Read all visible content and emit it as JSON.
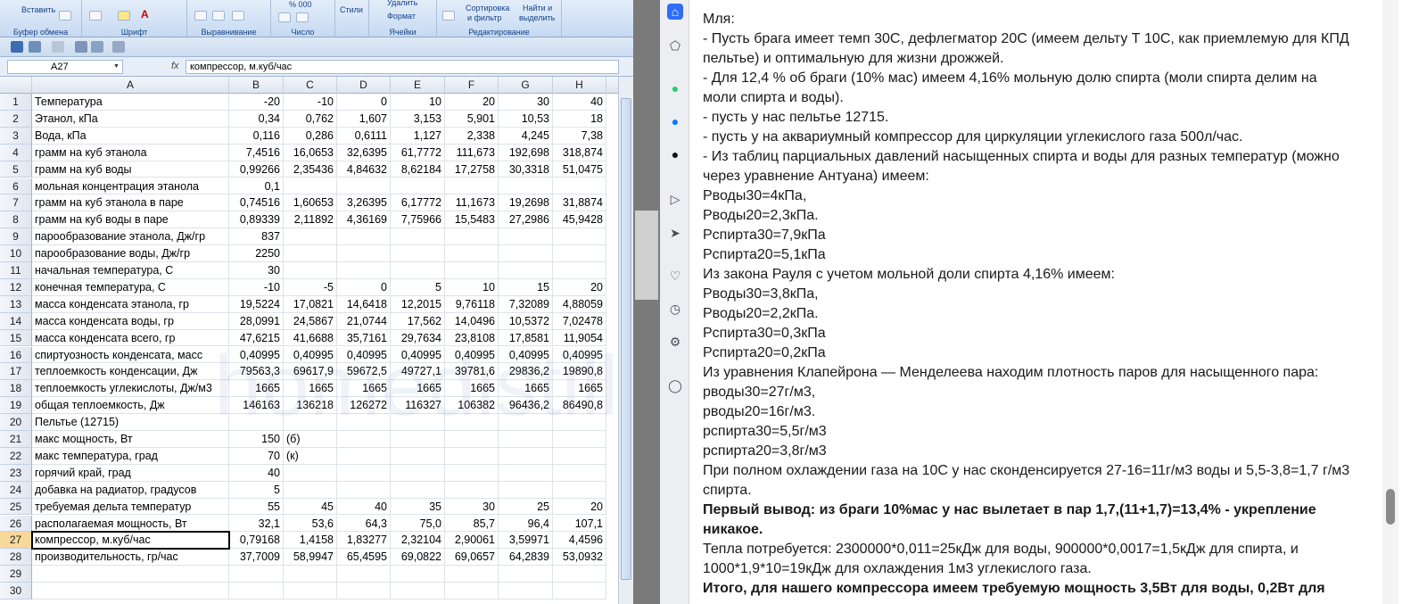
{
  "ribbon": {
    "groups": [
      "Буфер обмена",
      "Шрифт",
      "Выравнивание",
      "Число",
      "Ячейки",
      "Редактирование"
    ],
    "paste_label": "Вставить",
    "styles_label": "Стили",
    "format_label": "Формат",
    "delete_label": "Удалить",
    "sort_label": "Сортировка",
    "sort_label2": "и фильтр",
    "find_label": "Найти и",
    "find_label2": "выделить",
    "number_format": "% 000"
  },
  "formula_bar": {
    "name_box": "A27",
    "fx": "fx",
    "content": "компрессор, м.куб/час"
  },
  "columns": [
    "A",
    "B",
    "C",
    "D",
    "E",
    "F",
    "G",
    "H"
  ],
  "rows": [
    {
      "n": "1",
      "a": "Температура",
      "v": [
        "-20",
        "-10",
        "0",
        "10",
        "20",
        "30",
        "40"
      ]
    },
    {
      "n": "2",
      "a": "Этанол, кПа",
      "v": [
        "0,34",
        "0,762",
        "1,607",
        "3,153",
        "5,901",
        "10,53",
        "18"
      ]
    },
    {
      "n": "3",
      "a": "Вода, кПа",
      "v": [
        "0,116",
        "0,286",
        "0,6111",
        "1,127",
        "2,338",
        "4,245",
        "7,38"
      ]
    },
    {
      "n": "4",
      "a": "грамм на куб этанола",
      "v": [
        "7,4516",
        "16,0653",
        "32,6395",
        "61,7772",
        "111,673",
        "192,698",
        "318,874"
      ]
    },
    {
      "n": "5",
      "a": "грамм на куб воды",
      "v": [
        "0,99266",
        "2,35436",
        "4,84632",
        "8,62184",
        "17,2758",
        "30,3318",
        "51,0475"
      ]
    },
    {
      "n": "6",
      "a": "мольная концентрация этанола",
      "v": [
        "0,1",
        "",
        "",
        "",
        "",
        "",
        ""
      ]
    },
    {
      "n": "7",
      "a": "грамм на куб этанола в паре",
      "v": [
        "0,74516",
        "1,60653",
        "3,26395",
        "6,17772",
        "11,1673",
        "19,2698",
        "31,8874"
      ]
    },
    {
      "n": "8",
      "a": "грамм на куб воды в паре",
      "v": [
        "0,89339",
        "2,11892",
        "4,36169",
        "7,75966",
        "15,5483",
        "27,2986",
        "45,9428"
      ]
    },
    {
      "n": "9",
      "a": " парообразование этанола, Дж/гр",
      "v": [
        "837",
        "",
        "",
        "",
        "",
        "",
        ""
      ]
    },
    {
      "n": "10",
      "a": " парообразование воды, Дж/гр",
      "v": [
        "2250",
        "",
        "",
        "",
        "",
        "",
        ""
      ]
    },
    {
      "n": "11",
      "a": "начальная температура, С",
      "v": [
        "30",
        "",
        "",
        "",
        "",
        "",
        ""
      ]
    },
    {
      "n": "12",
      "a": "конечная температура, С",
      "v": [
        "-10",
        "-5",
        "0",
        "5",
        "10",
        "15",
        "20"
      ]
    },
    {
      "n": "13",
      "a": "масса конденсата этанола, гр",
      "v": [
        "19,5224",
        "17,0821",
        "14,6418",
        "12,2015",
        "9,76118",
        "7,32089",
        "4,88059"
      ]
    },
    {
      "n": "14",
      "a": "масса конденсата воды, гр",
      "v": [
        "28,0991",
        "24,5867",
        "21,0744",
        "17,562",
        "14,0496",
        "10,5372",
        "7,02478"
      ]
    },
    {
      "n": "15",
      "a": "масса конденсата всего, гр",
      "v": [
        "47,6215",
        "41,6688",
        "35,7161",
        "29,7634",
        "23,8108",
        "17,8581",
        "11,9054"
      ]
    },
    {
      "n": "16",
      "a": "спиртуозность  конденсата, масс",
      "v": [
        "0,40995",
        "0,40995",
        "0,40995",
        "0,40995",
        "0,40995",
        "0,40995",
        "0,40995"
      ]
    },
    {
      "n": "17",
      "a": "теплоемкость конденсации, Дж",
      "v": [
        "79563,3",
        "69617,9",
        "59672,5",
        "49727,1",
        "39781,6",
        "29836,2",
        "19890,8"
      ]
    },
    {
      "n": "18",
      "a": "теплоемкость углекислоты, Дж/м3",
      "v": [
        "1665",
        "1665",
        "1665",
        "1665",
        "1665",
        "1665",
        "1665"
      ]
    },
    {
      "n": "19",
      "a": "общая теплоемкость, Дж",
      "v": [
        "146163",
        "136218",
        "126272",
        "116327",
        "106382",
        "96436,2",
        "86490,8"
      ]
    },
    {
      "n": "20",
      "a": "Пельтье (12715)",
      "v": [
        "",
        "",
        "",
        "",
        "",
        "",
        ""
      ]
    },
    {
      "n": "21",
      "a": "макс мощность, Вт",
      "v": [
        "150",
        "(б)",
        "",
        "",
        "",
        "",
        ""
      ]
    },
    {
      "n": "22",
      "a": "макс температура, град",
      "v": [
        "70",
        "(к)",
        "",
        "",
        "",
        "",
        ""
      ]
    },
    {
      "n": "23",
      "a": "горячий край, град",
      "v": [
        "40",
        "",
        "",
        "",
        "",
        "",
        ""
      ]
    },
    {
      "n": "24",
      "a": "добавка на радиатор, градусов",
      "v": [
        "5",
        "",
        "",
        "",
        "",
        "",
        ""
      ]
    },
    {
      "n": "25",
      "a": "требуемая дельта температур",
      "v": [
        "55",
        "45",
        "40",
        "35",
        "30",
        "25",
        "20"
      ]
    },
    {
      "n": "26",
      "a": "располагаемая мощность, Вт",
      "v": [
        "32,1",
        "53,6",
        "64,3",
        "75,0",
        "85,7",
        "96,4",
        "107,1"
      ]
    },
    {
      "n": "27",
      "a": "компрессор, м.куб/час",
      "v": [
        "0,79168",
        "1,4158",
        "1,83277",
        "2,32104",
        "2,90061",
        "3,59971",
        "4,4596"
      ]
    },
    {
      "n": "28",
      "a": "производительность, гр/час",
      "v": [
        "37,7009",
        "58,9947",
        "65,4595",
        "69,0822",
        "69,0657",
        "64,2839",
        "53,0932"
      ]
    },
    {
      "n": "29",
      "a": "",
      "v": [
        "",
        "",
        "",
        "",
        "",
        "",
        ""
      ]
    },
    {
      "n": "30",
      "a": "",
      "v": [
        "",
        "",
        "",
        "",
        "",
        "",
        ""
      ]
    }
  ],
  "article": {
    "lines": [
      {
        "t": "Мля:",
        "b": false
      },
      {
        "t": "- Пусть брага имеет темп 30С, дефлегматор 20С (имеем дельту Т 10С, как приемлемую для КПД",
        "b": false
      },
      {
        "t": "пельтье) и оптимальную для жизни дрожжей.",
        "b": false
      },
      {
        "t": "- Для 12,4 % об браги (10% мас) имеем 4,16% мольную долю спирта (моли спирта делим на",
        "b": false
      },
      {
        "t": "моли спирта и воды).",
        "b": false
      },
      {
        "t": "- пусть у нас пельтье 12715.",
        "b": false
      },
      {
        "t": "- пусть у на аквариумный компрессор для циркуляции углекислого газа 500л/час.",
        "b": false
      },
      {
        "t": "- Из таблиц парциальных давлений насыщенных спирта и воды для разных температур (можно",
        "b": false
      },
      {
        "t": "через уравнение Антуана) имеем:",
        "b": false
      },
      {
        "t": "Рводы30=4кПа,",
        "b": false
      },
      {
        "t": "Рводы20=2,3кПа.",
        "b": false
      },
      {
        "t": "Рспирта30=7,9кПа",
        "b": false
      },
      {
        "t": "Рспирта20=5,1кПа",
        "b": false
      },
      {
        "t": "Из закона Рауля с учетом мольной доли спирта 4,16% имеем:",
        "b": false
      },
      {
        "t": "Рводы30=3,8кПа,",
        "b": false
      },
      {
        "t": "Рводы20=2,2кПа.",
        "b": false
      },
      {
        "t": "Рспирта30=0,3кПа",
        "b": false
      },
      {
        "t": "Рспирта20=0,2кПа",
        "b": false
      },
      {
        "t": "Из уравнения Клапейрона — Менделеева находим плотность паров для насыщенного пара:",
        "b": false
      },
      {
        "t": "рводы30=27г/м3,",
        "b": false
      },
      {
        "t": "рводы20=16г/м3.",
        "b": false
      },
      {
        "t": "рспирта30=5,5г/м3",
        "b": false
      },
      {
        "t": "рспирта20=3,8г/м3",
        "b": false
      },
      {
        "t": "При полном охлаждении газа на 10С у нас сконденсируется 27-16=11г/м3 воды и 5,5-3,8=1,7 г/м3",
        "b": false
      },
      {
        "t": "спирта.",
        "b": false
      },
      {
        "t": "Первый вывод: из браги 10%мас у нас вылетает в пар 1,7,(11+1,7)=13,4% - укрепление",
        "b": true
      },
      {
        "t": "никакое.",
        "b": true
      },
      {
        "t": "Тепла потребуется: 2300000*0,011=25кДж для воды, 900000*0,0017=1,5кДж для спирта, и",
        "b": false
      },
      {
        "t": "1000*1,9*10=19кДж для охлаждения 1м3 углекислого газа.",
        "b": false
      },
      {
        "t": "Итого, для нашего компрессора имеем требуемую мощность 3,5Вт для воды, 0,2Вт для",
        "b": true
      }
    ]
  },
  "watermark": "homedistiller.ru"
}
